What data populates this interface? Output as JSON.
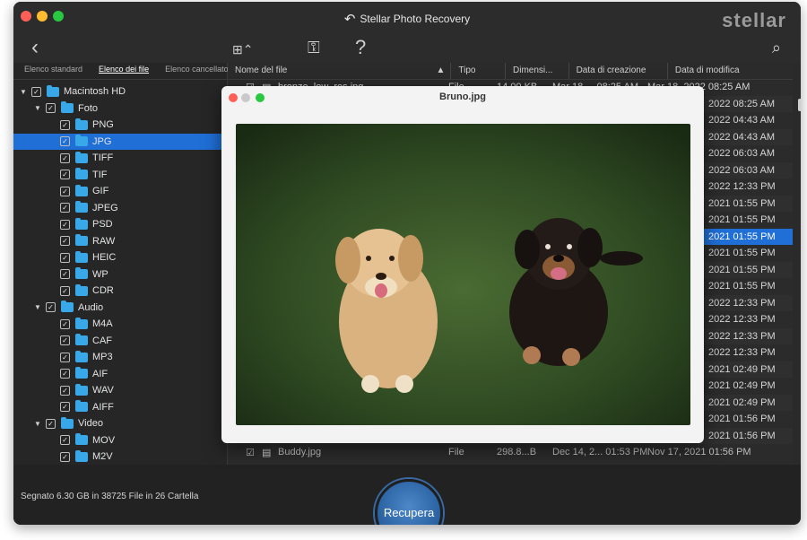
{
  "app": {
    "title": "Stellar Photo Recovery",
    "brand": "stellar"
  },
  "toolbar": {
    "back": "‹",
    "view_icon": "⊞⌃",
    "key_icon": "⚿",
    "help": "?",
    "search_icon": "⌕"
  },
  "sidebar": {
    "tabs": [
      "Elenco standard",
      "Elenco dei file",
      "Elenco cancellato"
    ],
    "tree": [
      {
        "label": "Macintosh HD",
        "level": 0
      },
      {
        "label": "Foto",
        "level": 1
      },
      {
        "label": "PNG",
        "level": 2
      },
      {
        "label": "JPG",
        "level": 2
      },
      {
        "label": "TIFF",
        "level": 2
      },
      {
        "label": "TIF",
        "level": 2
      },
      {
        "label": "GIF",
        "level": 2
      },
      {
        "label": "JPEG",
        "level": 2
      },
      {
        "label": "PSD",
        "level": 2
      },
      {
        "label": "RAW",
        "level": 2
      },
      {
        "label": "HEIC",
        "level": 2
      },
      {
        "label": "WP",
        "level": 2
      },
      {
        "label": "CDR",
        "level": 2
      },
      {
        "label": "Audio",
        "level": 1
      },
      {
        "label": "M4A",
        "level": 2
      },
      {
        "label": "CAF",
        "level": 2
      },
      {
        "label": "MP3",
        "level": 2
      },
      {
        "label": "AIF",
        "level": 2
      },
      {
        "label": "WAV",
        "level": 2
      },
      {
        "label": "AIFF",
        "level": 2
      },
      {
        "label": "Video",
        "level": 1
      },
      {
        "label": "MOV",
        "level": 2
      },
      {
        "label": "M2V",
        "level": 2
      }
    ]
  },
  "filelist": {
    "columns": [
      "Nome del file",
      "Tipo",
      "Dimensi...",
      "Data di creazione",
      "Data di modifica"
    ],
    "top_partial": {
      "name": "bronze_low_res.jpg",
      "type": "File",
      "size": "14.00 KB",
      "created": "Mar 18,... 08:25 AM",
      "modified": "Mar 18, 2022 08:25 AM"
    },
    "modified_visible": [
      "2022 08:25 AM",
      "2022 04:43 AM",
      "2022 04:43 AM",
      "2022 06:03 AM",
      "2022 06:03 AM",
      "2022 12:33 PM",
      "2021 01:55 PM",
      "2021 01:55 PM",
      "2021 01:55 PM",
      "2021 01:55 PM",
      "2021 01:55 PM",
      "2021 01:55 PM",
      "2022 12:33 PM",
      "2022 12:33 PM",
      "2022 12:33 PM",
      "2022 12:33 PM",
      "2021 02:49 PM",
      "2021 02:49 PM",
      "2021 02:49 PM",
      "2021 01:56 PM",
      "2021 01:56 PM"
    ],
    "selected_index": 8,
    "bottom_row": {
      "name": "Buddy.jpg",
      "type": "File",
      "size": "298.8...B",
      "created": "Dec 14, 2... 01:53 PM",
      "modified": "Nov 17, 2021 01:56 PM"
    }
  },
  "footer": {
    "status": "Segnato 6.30 GB in 38725 File in 26 Cartella",
    "recover": "Recupera"
  },
  "preview": {
    "title": "Bruno.jpg"
  }
}
